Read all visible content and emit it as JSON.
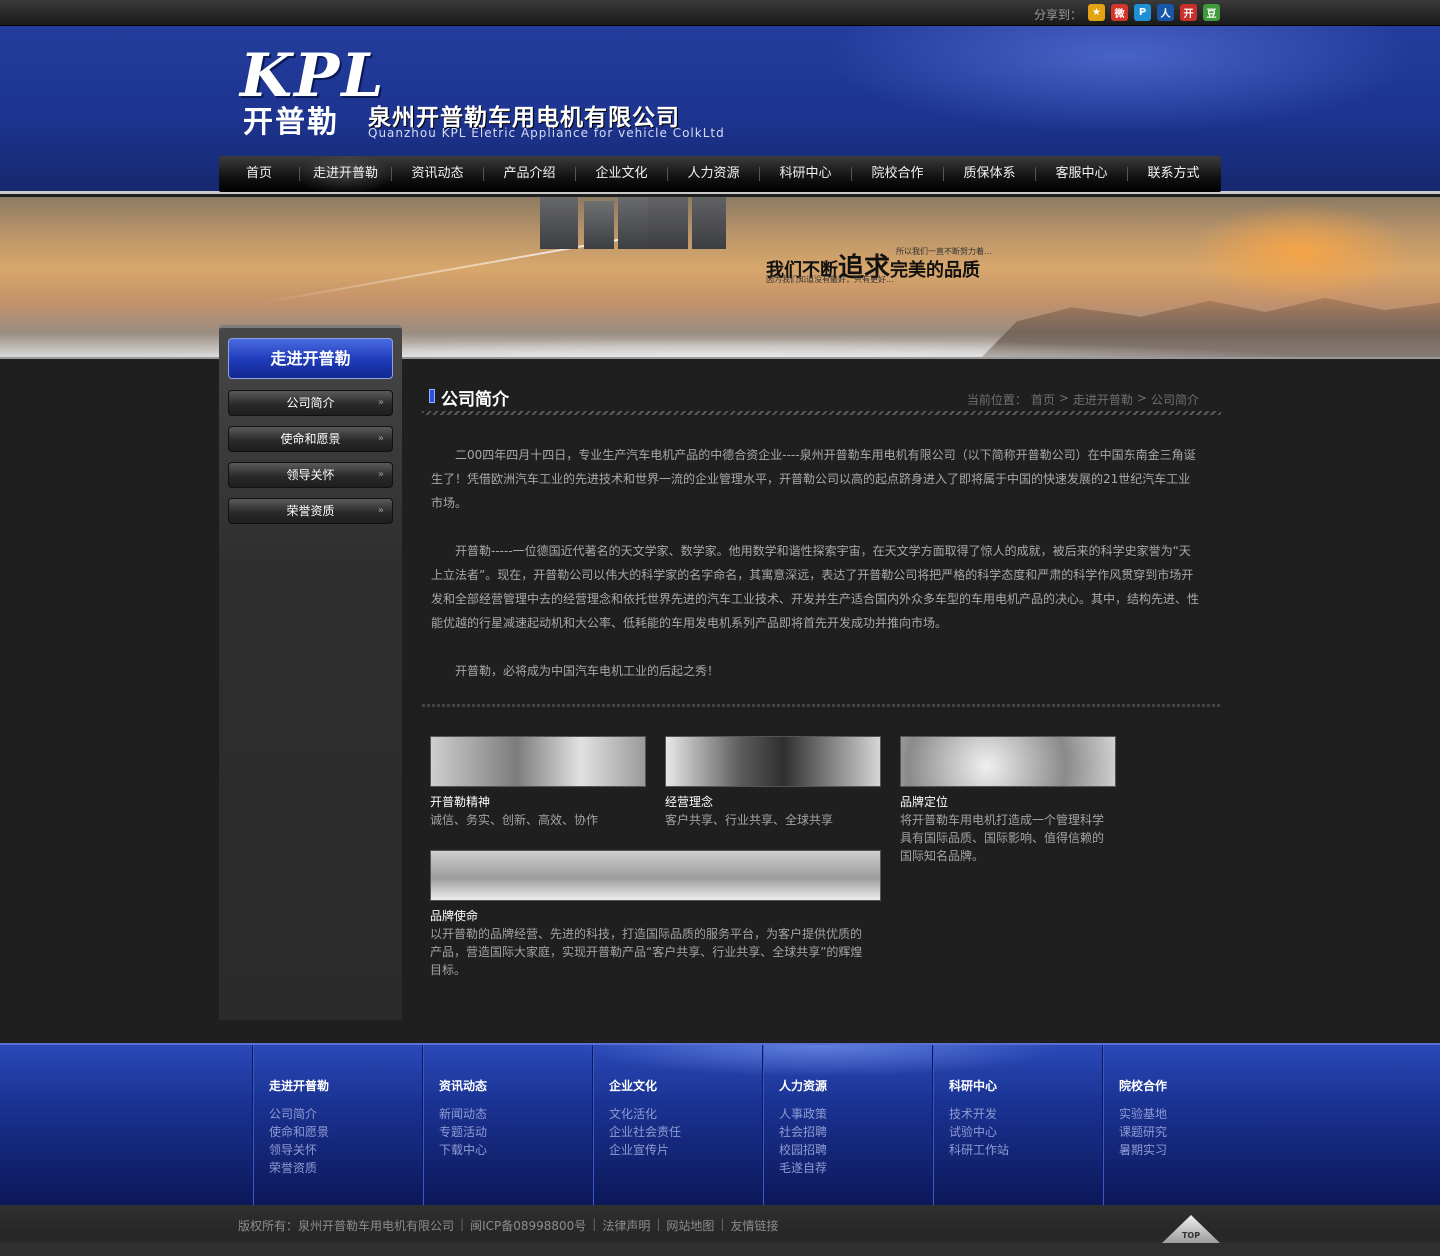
{
  "share": {
    "label": "分享到：",
    "icons": [
      {
        "name": "qzone-icon",
        "color": "#e2a312",
        "glyph": "★"
      },
      {
        "name": "weibo-icon",
        "color": "#d4352a",
        "glyph": "微"
      },
      {
        "name": "tencent-weibo-icon",
        "color": "#1f8fd6",
        "glyph": "P"
      },
      {
        "name": "renren-icon",
        "color": "#1856a8",
        "glyph": "人"
      },
      {
        "name": "kaixin-icon",
        "color": "#c8312b",
        "glyph": "开"
      },
      {
        "name": "douban-icon",
        "color": "#3e9a3a",
        "glyph": "豆"
      }
    ]
  },
  "header": {
    "logo_kpl": "KPL",
    "logo_cn": "开普勒",
    "company_cn": "泉州开普勒车用电机有限公司",
    "company_en": "Quanzhou KPL Eletric Appliance for vehicle ColkLtd"
  },
  "nav": {
    "items": [
      "首页",
      "走进开普勒",
      "资讯动态",
      "产品介绍",
      "企业文化",
      "人力资源",
      "科研中心",
      "院校合作",
      "质保体系",
      "客服中心",
      "联系方式"
    ],
    "active_index": 1
  },
  "banner": {
    "slogan_pre": "我们不断",
    "slogan_em": "追求",
    "slogan_post": "完美的品质",
    "sub1": "所以我们一直不断努力着...",
    "sub2": "因为我们知道没有最好，只有更好..."
  },
  "sidebar": {
    "title": "走进开普勒",
    "items": [
      "公司简介",
      "使命和愿景",
      "领导关怀",
      "荣誉资质"
    ],
    "arrow": "»"
  },
  "main": {
    "title": "公司简介",
    "breadcrumb": {
      "label": "当前位置：",
      "items": [
        "首页",
        "走进开普勒",
        "公司简介"
      ],
      "separator": ">"
    },
    "paragraphs": [
      "二00四年四月十四日，专业生产汽车电机产品的中德合资企业----泉州开普勒车用电机有限公司（以下简称开普勒公司）在中国东南金三角诞生了！凭借欧洲汽车工业的先进技术和世界一流的企业管理水平，开普勒公司以高的起点跻身进入了即将属于中国的快速发展的21世纪汽车工业市场。",
      "开普勒-----一位德国近代著名的天文学家、数学家。他用数学和谐性探索宇宙，在天文学方面取得了惊人的成就，被后来的科学史家誉为“天上立法者”。现在，开普勒公司以伟大的科学家的名字命名，其寓意深远，表达了开普勒公司将把严格的科学态度和严肃的科学作风贯穿到市场开发和全部经营管理中去的经营理念和依托世界先进的汽车工业技术、开发并生产适合国内外众多车型的车用电机产品的决心。其中，结构先进、性能优越的行星减速起动机和大公率、低耗能的车用发电机系列产品即将首先开发成功并推向市场。",
      "开普勒，必将成为中国汽车电机工业的后起之秀！"
    ],
    "cards": [
      {
        "title": "开普勒精神",
        "text": "诚信、务实、创新、高效、协作"
      },
      {
        "title": "经营理念",
        "text": "客户共享、行业共享、全球共享"
      },
      {
        "title": "品牌定位",
        "text": "将开普勒车用电机打造成一个管理科学具有国际品质、国际影响、值得信赖的国际知名品牌。"
      },
      {
        "title": "品牌使命",
        "text": "以开普勒的品牌经营、先进的科技，打造国际品质的服务平台，为客户提供优质的产品，营造国际大家庭，实现开普勒产品“客户共享、行业共享、全球共享”的辉煌目标。"
      }
    ]
  },
  "footer": {
    "columns": [
      {
        "title": "走进开普勒",
        "links": [
          "公司简介",
          "使命和愿景",
          "领导关怀",
          "荣誉资质"
        ]
      },
      {
        "title": "资讯动态",
        "links": [
          "新闻动态",
          "专题活动",
          "下载中心"
        ]
      },
      {
        "title": "企业文化",
        "links": [
          "文化活化",
          "企业社会责任",
          "企业宣传片"
        ]
      },
      {
        "title": "人力资源",
        "links": [
          "人事政策",
          "社会招聘",
          "校园招聘",
          "毛遂自荐"
        ]
      },
      {
        "title": "科研中心",
        "links": [
          "技术开发",
          "试验中心",
          "科研工作站"
        ]
      },
      {
        "title": "院校合作",
        "links": [
          "实验基地",
          "课题研究",
          "暑期实习"
        ]
      }
    ],
    "copyright": "版权所有：泉州开普勒车用电机有限公司",
    "icp": "闽ICP备08998800号",
    "links": [
      "法律声明",
      "网站地图",
      "友情链接"
    ],
    "separator": "|",
    "top_label": "TOP"
  }
}
